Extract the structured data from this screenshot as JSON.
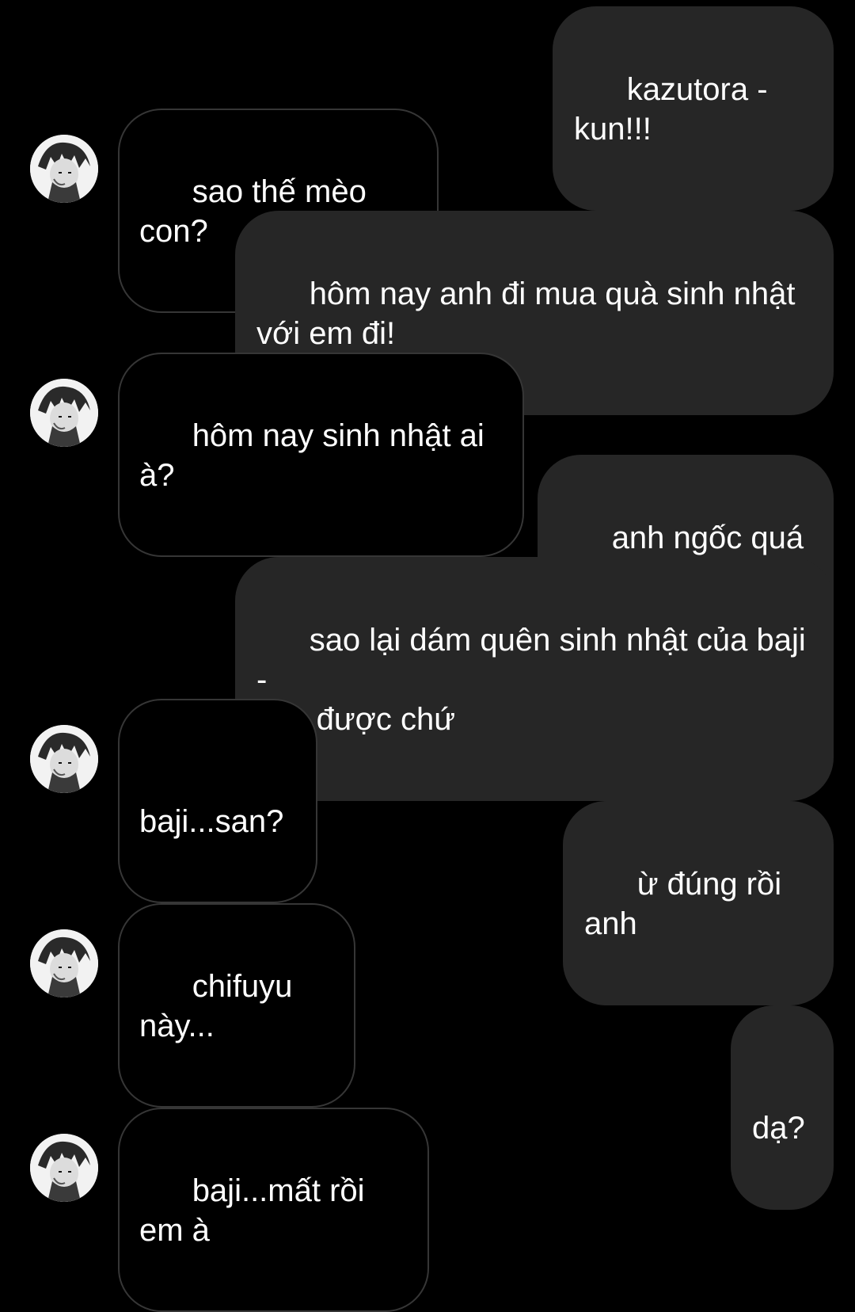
{
  "conversation": {
    "contact_avatar": "contact-avatar-icon",
    "colors": {
      "background": "#000000",
      "outgoing_bubble": "#262626",
      "incoming_border": "#363636",
      "text": "#ffffff"
    },
    "messages": [
      {
        "direction": "outgoing",
        "text": "kazutora - kun!!!"
      },
      {
        "direction": "incoming",
        "text": "sao thế mèo con?"
      },
      {
        "direction": "outgoing",
        "text": "hôm nay anh đi mua quà sinh nhật\nvới em đi!"
      },
      {
        "direction": "incoming",
        "text": "hôm nay sinh nhật ai à?"
      },
      {
        "direction": "outgoing",
        "text": "anh ngốc quá đó"
      },
      {
        "direction": "outgoing",
        "text": "sao lại dám quên sinh nhật của baji -\nsan được chứ"
      },
      {
        "direction": "incoming",
        "text": "baji...san?"
      },
      {
        "direction": "outgoing",
        "text": "ừ đúng rồi anh"
      },
      {
        "direction": "incoming",
        "text": "chifuyu này..."
      },
      {
        "direction": "outgoing",
        "text": "dạ?"
      },
      {
        "direction": "incoming",
        "text": "baji...mất rồi em à"
      }
    ]
  }
}
